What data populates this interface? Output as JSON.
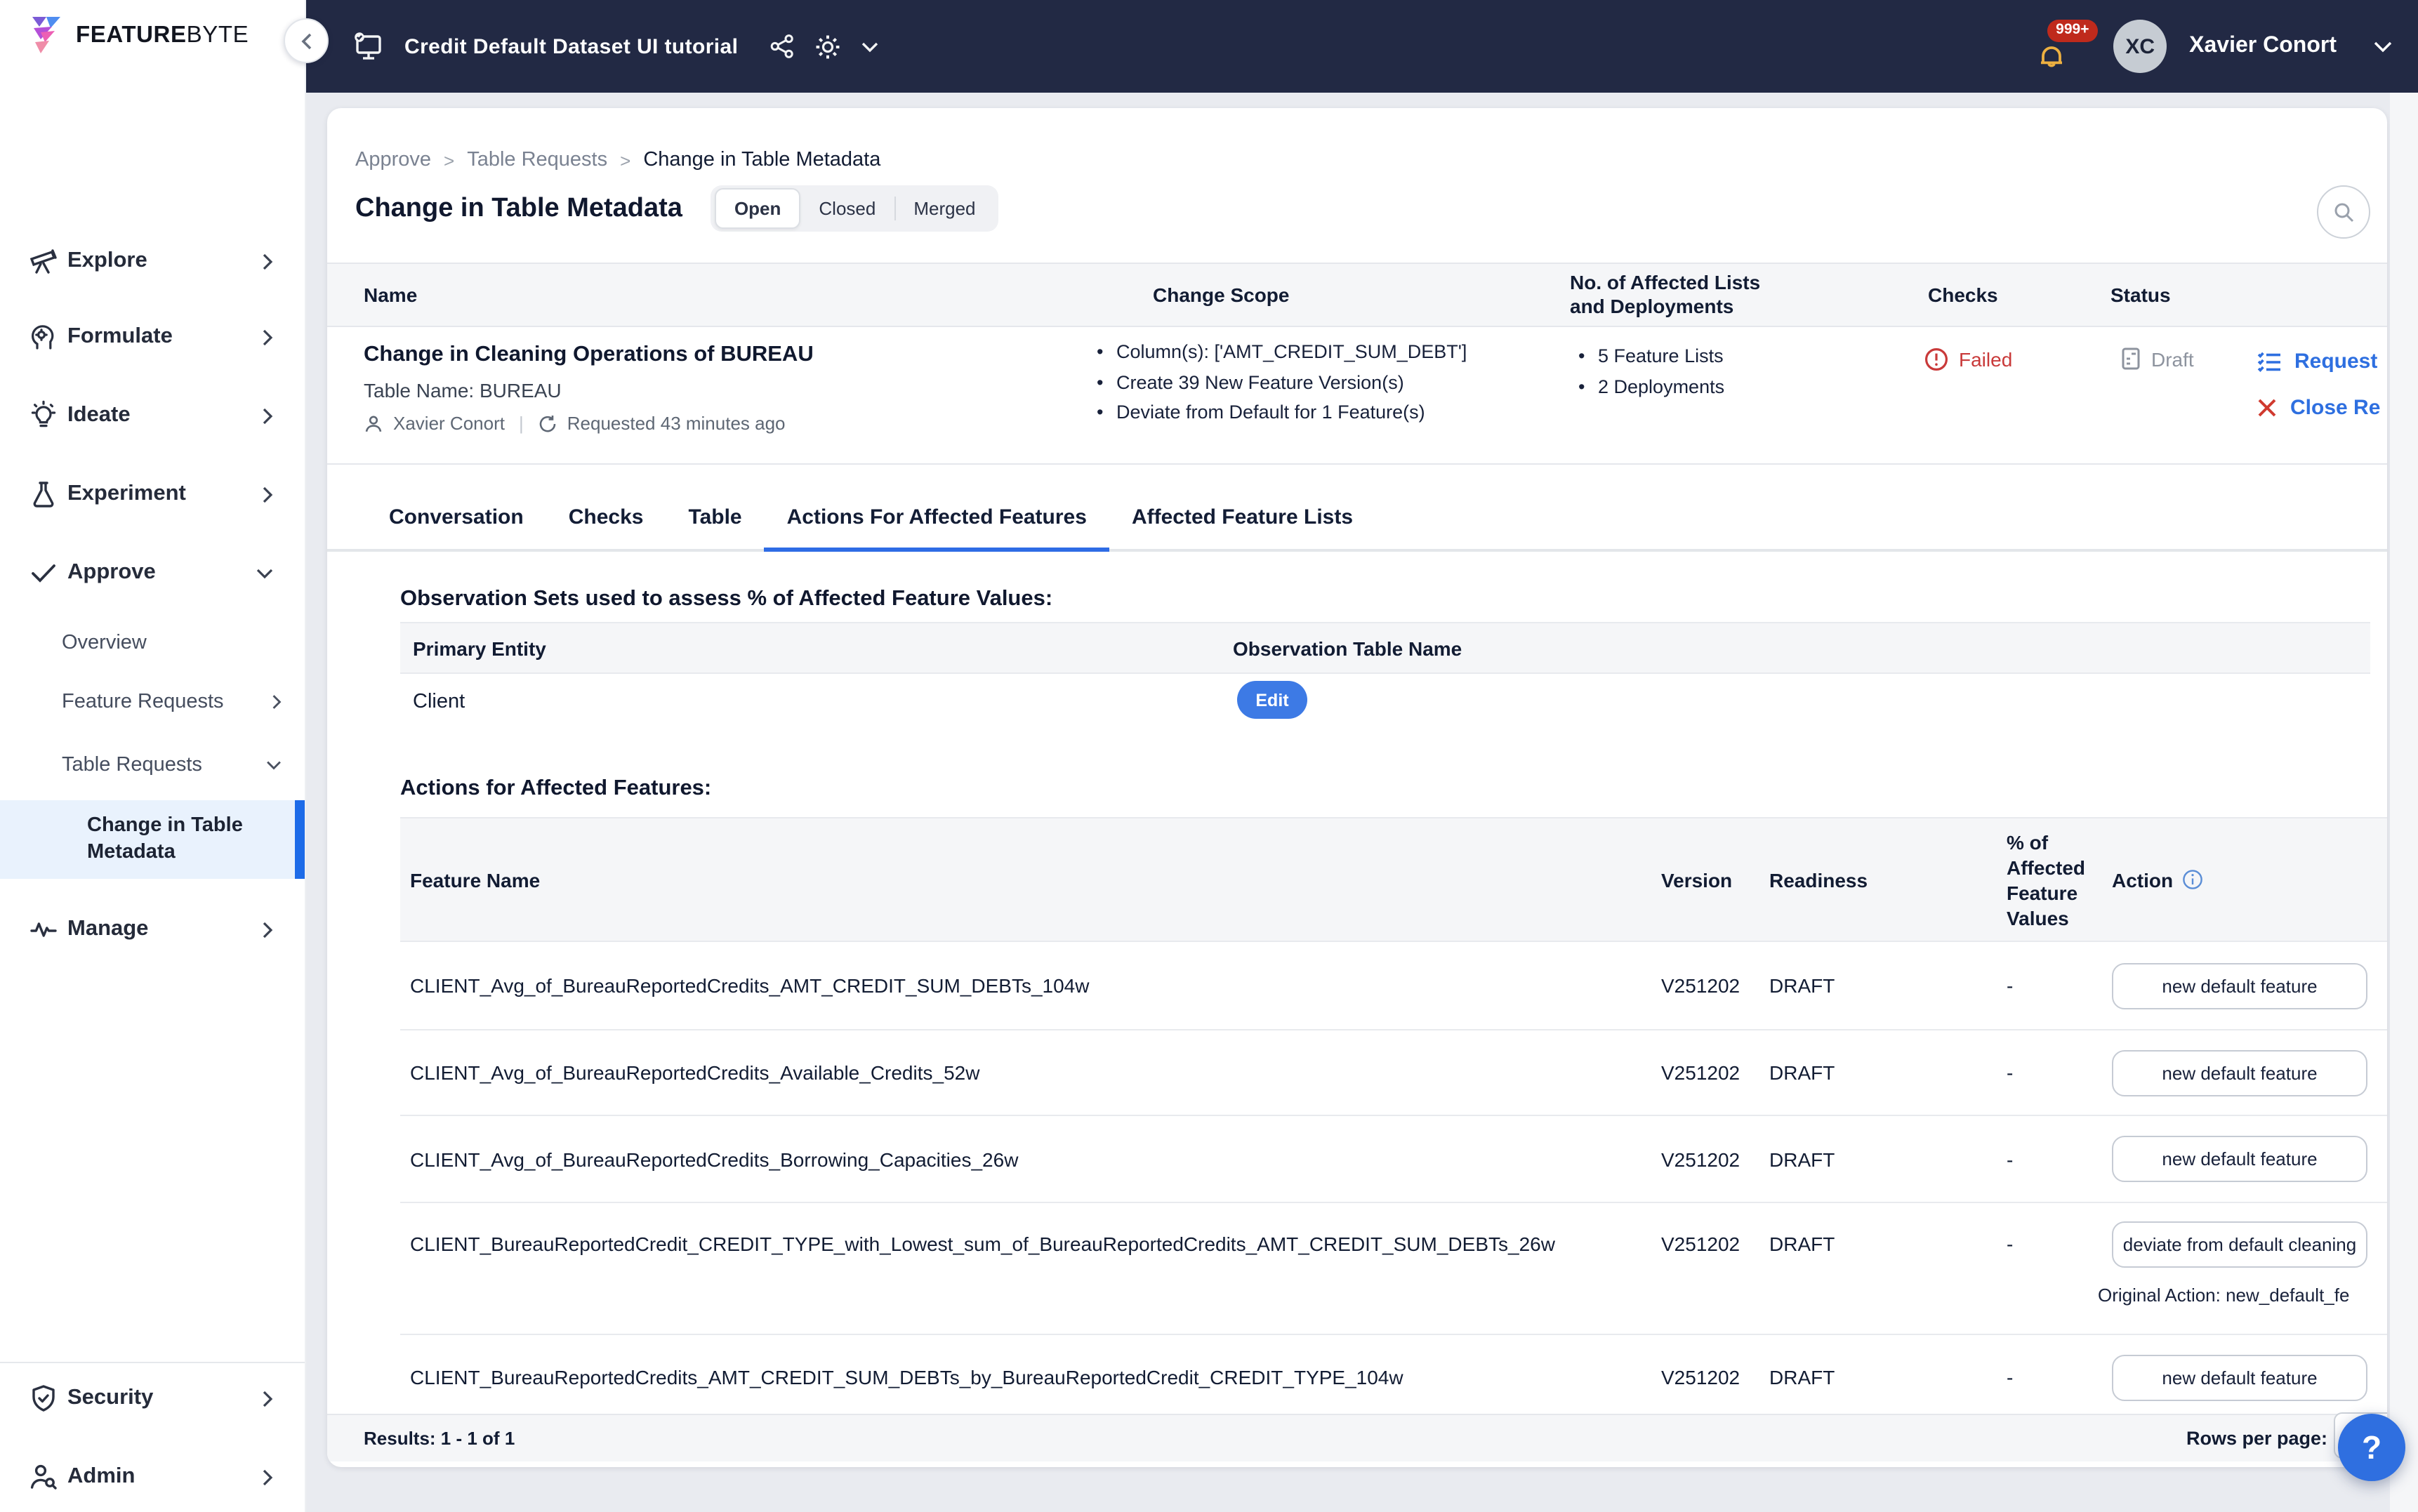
{
  "brand": {
    "bold": "FEATURE",
    "light": "BYTE"
  },
  "topbar": {
    "workspace_label": "Credit Default Dataset UI tutorial",
    "notifications_badge": "999+",
    "avatar_initials": "XC",
    "user_name": "Xavier Conort"
  },
  "sidebar": {
    "items": [
      {
        "label": "Explore"
      },
      {
        "label": "Formulate"
      },
      {
        "label": "Ideate"
      },
      {
        "label": "Experiment"
      },
      {
        "label": "Approve"
      },
      {
        "label": "Manage"
      },
      {
        "label": "Security"
      },
      {
        "label": "Admin"
      }
    ],
    "approve_children": [
      "Overview",
      "Feature Requests",
      "Table Requests"
    ],
    "active_item": "Change in Table Metadata"
  },
  "breadcrumb": {
    "items": [
      "Approve",
      "Table Requests",
      "Change in Table Metadata"
    ],
    "separator": ">"
  },
  "page": {
    "title": "Change in Table Metadata",
    "filters": [
      "Open",
      "Closed",
      "Merged"
    ],
    "active_filter": "Open"
  },
  "requests": {
    "headers": {
      "name": "Name",
      "scope": "Change Scope",
      "affected": "No. of Affected Lists and Deployments",
      "checks": "Checks",
      "status": "Status"
    },
    "row": {
      "title": "Change in Cleaning Operations of BUREAU",
      "table_name": "Table Name: BUREAU",
      "requester": "Xavier Conort",
      "meta_separator": "|",
      "requested": "Requested 43 minutes ago",
      "scope": [
        "Column(s): ['AMT_CREDIT_SUM_DEBT']",
        "Create 39 New Feature Version(s)",
        "Deviate from Default for 1 Feature(s)"
      ],
      "affected": [
        "5 Feature Lists",
        "2 Deployments"
      ],
      "checks": "Failed",
      "status": "Draft",
      "action_request": "Request",
      "action_close": "Close Re"
    }
  },
  "tabs": {
    "items": [
      "Conversation",
      "Checks",
      "Table",
      "Actions For Affected Features",
      "Affected Feature Lists"
    ],
    "active": "Actions For Affected Features"
  },
  "observation": {
    "heading": "Observation Sets used to assess % of Affected Feature Values:",
    "headers": {
      "entity": "Primary Entity",
      "table": "Observation Table Name"
    },
    "row": {
      "entity": "Client",
      "action": "Edit"
    }
  },
  "actions": {
    "heading": "Actions for Affected Features:",
    "headers": {
      "feature": "Feature Name",
      "version": "Version",
      "readiness": "Readiness",
      "pct": "% of Affected Feature Values",
      "action": "Action"
    },
    "rows": [
      {
        "name": "CLIENT_Avg_of_BureauReportedCredits_AMT_CREDIT_SUM_DEBTs_104w",
        "version": "V251202",
        "readiness": "DRAFT",
        "pct": "-",
        "action": "new default feature"
      },
      {
        "name": "CLIENT_Avg_of_BureauReportedCredits_Available_Credits_52w",
        "version": "V251202",
        "readiness": "DRAFT",
        "pct": "-",
        "action": "new default feature"
      },
      {
        "name": "CLIENT_Avg_of_BureauReportedCredits_Borrowing_Capacities_26w",
        "version": "V251202",
        "readiness": "DRAFT",
        "pct": "-",
        "action": "new default feature"
      },
      {
        "name": "CLIENT_BureauReportedCredit_CREDIT_TYPE_with_Lowest_sum_of_BureauReportedCredits_AMT_CREDIT_SUM_DEBTs_26w",
        "version": "V251202",
        "readiness": "DRAFT",
        "pct": "-",
        "action": "deviate from default cleaning",
        "original_action": "Original Action: new_default_fe"
      },
      {
        "name": "CLIENT_BureauReportedCredits_AMT_CREDIT_SUM_DEBTs_by_BureauReportedCredit_CREDIT_TYPE_104w",
        "version": "V251202",
        "readiness": "DRAFT",
        "pct": "-",
        "action": "new default feature"
      }
    ]
  },
  "footer": {
    "results": "Results: 1 - 1 of 1",
    "rows_per_page": "Rows per page:"
  },
  "icons": {
    "help": "?",
    "info": "i"
  },
  "colors": {
    "topbar": "#222944",
    "accent_blue": "#2e6fe0",
    "tab_underline": "#2e6ce5",
    "failed_red": "#c93a3a",
    "close_red": "#d03a2f",
    "draft_gray": "#8d939e",
    "active_sidebar_bg": "#e9f2fd",
    "active_sidebar_bar": "#1d6be8",
    "bell_yellow": "#edb041",
    "badge_red": "#bf2a1c",
    "edit_button": "#3d7ae5",
    "header_bg": "#f5f6f8",
    "page_bg": "#e9ebf0"
  }
}
